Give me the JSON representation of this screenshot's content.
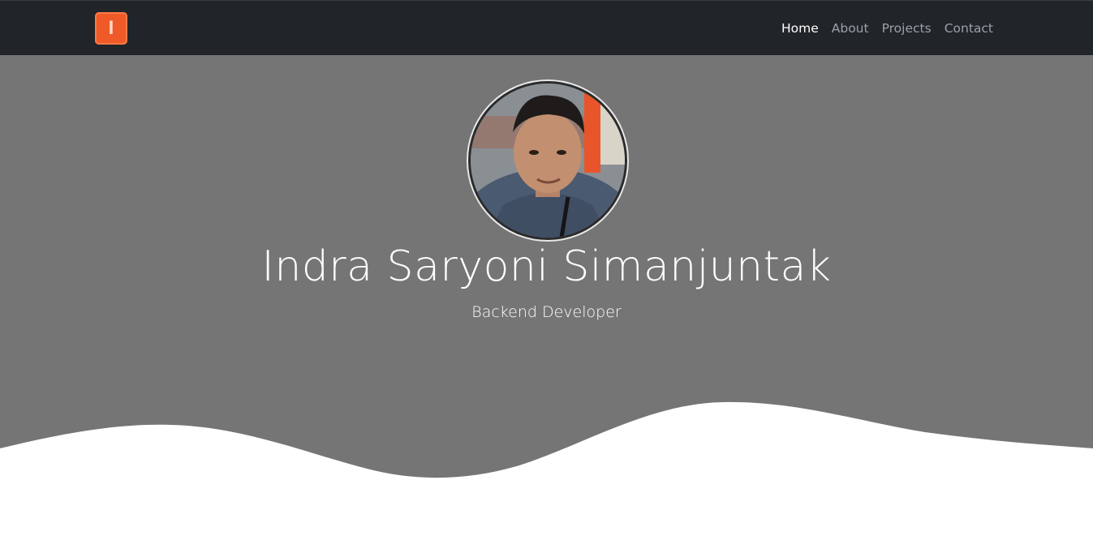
{
  "brand": {
    "letter": "I"
  },
  "nav": {
    "items": [
      {
        "label": "Home",
        "active": true
      },
      {
        "label": "About",
        "active": false
      },
      {
        "label": "Projects",
        "active": false
      },
      {
        "label": "Contact",
        "active": false
      }
    ]
  },
  "hero": {
    "name": "Indra Saryoni Simanjuntak",
    "role": "Backend Developer"
  },
  "colors": {
    "navbar_bg": "#212529",
    "hero_bg": "#757575",
    "brand_accent": "#f05a28",
    "wave_fill": "#ffffff"
  }
}
